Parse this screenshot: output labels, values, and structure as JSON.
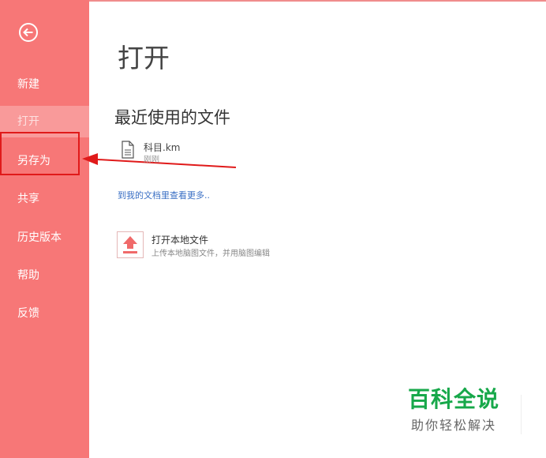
{
  "sidebar": {
    "items": [
      {
        "label": "新建"
      },
      {
        "label": "打开"
      },
      {
        "label": "另存为"
      },
      {
        "label": "共享"
      },
      {
        "label": "历史版本"
      },
      {
        "label": "帮助"
      },
      {
        "label": "反馈"
      }
    ],
    "active_index": 1,
    "background": "#f77777"
  },
  "main": {
    "title": "打开",
    "recent_title": "最近使用的文件",
    "recent_files": [
      {
        "name": "科目.km",
        "time": "刚刚"
      }
    ],
    "more_link": "到我的文档里查看更多..",
    "local": {
      "title": "打开本地文件",
      "description": "上传本地脑图文件，并用脑图编辑"
    }
  },
  "watermark": {
    "title": "百科全说",
    "subtitle": "助你轻松解决",
    "color": "#17a84a"
  },
  "icons": {
    "back": "back-arrow-circle-icon",
    "file": "document-icon",
    "upload": "upload-icon"
  },
  "annotation_color": "#e01a1a"
}
